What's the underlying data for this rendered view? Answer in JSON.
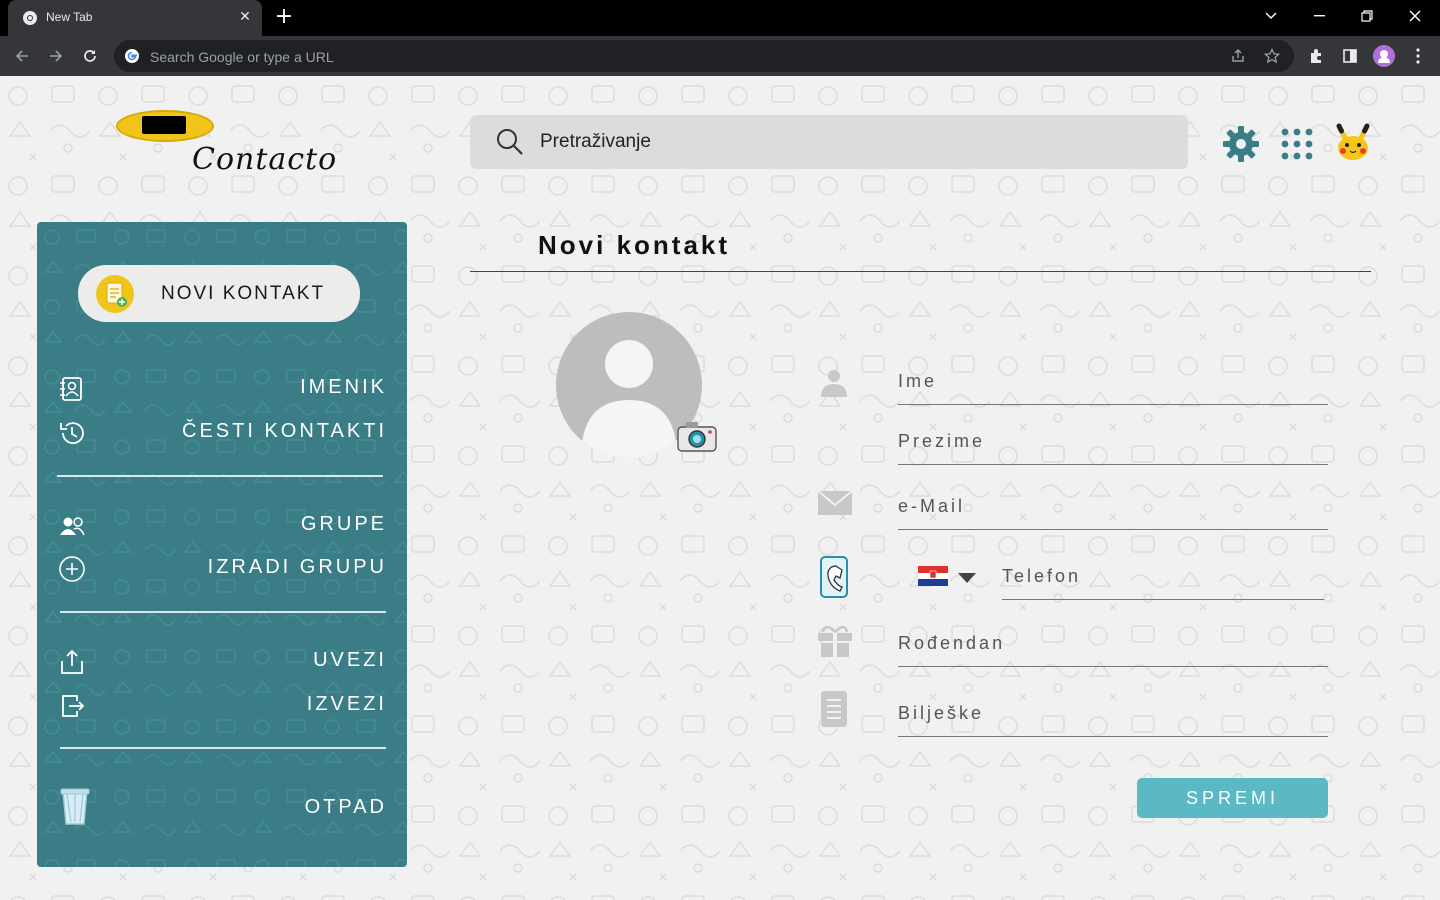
{
  "browser": {
    "tab_title": "New Tab",
    "omnibox_placeholder": "Search Google or type a URL"
  },
  "app": {
    "logo_text": "Contacto",
    "search_placeholder": "Pretraživanje"
  },
  "sidebar": {
    "new_contact_label": "NOVI KONTAKT",
    "items": [
      {
        "label": "IMENIK",
        "icon": "contacts-book-icon"
      },
      {
        "label": "ČESTI KONTAKTI",
        "icon": "history-icon"
      },
      {
        "label": "GRUPE",
        "icon": "group-icon"
      },
      {
        "label": "IZRADI GRUPU",
        "icon": "add-circle-icon"
      },
      {
        "label": "UVEZI",
        "icon": "upload-icon"
      },
      {
        "label": "IZVEZI",
        "icon": "export-icon"
      },
      {
        "label": "OTPAD",
        "icon": "trash-icon"
      }
    ]
  },
  "form": {
    "title": "Novi kontakt",
    "fields": {
      "first_name": "Ime",
      "last_name": "Prezime",
      "email": "e-Mail",
      "phone": "Telefon",
      "birthday": "Rođendan",
      "notes": "Bilješke"
    },
    "save_label": "SPREMI"
  },
  "colors": {
    "sidebar": "#3a7d86",
    "save_button": "#5bb9c6",
    "search_bg": "#dcdcdc"
  }
}
